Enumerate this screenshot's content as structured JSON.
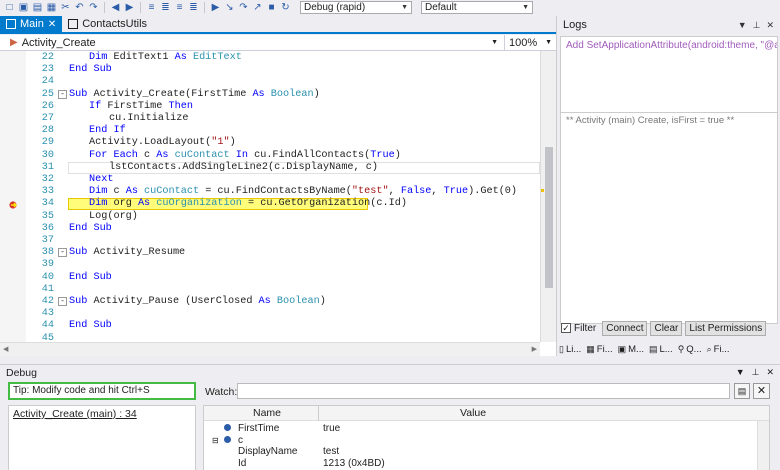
{
  "toolbar": {
    "icons": [
      "new-file-icon",
      "save-icon",
      "save-all-icon",
      "grid-icon",
      "cut-icon",
      "undo-icon",
      "redo-icon",
      "nav-back-icon",
      "nav-forward-icon",
      "indent-icon",
      "outdent-icon",
      "comment-icon",
      "uncomment-icon",
      "run-icon",
      "step-into-icon",
      "step-over-icon",
      "step-out-icon",
      "stop-icon",
      "restart-icon"
    ],
    "build_config": "Debug (rapid)",
    "device": "Default"
  },
  "editor": {
    "tabs": [
      {
        "label": "Main",
        "active": true
      },
      {
        "label": "ContactsUtils",
        "active": false
      }
    ],
    "sub_selector": "Activity_Create",
    "zoom": "100%",
    "lines": [
      {
        "n": "22",
        "indent": 1,
        "tokens": [
          [
            "kw",
            "Dim "
          ],
          [
            "",
            "EditText1 "
          ],
          [
            "kw",
            "As "
          ],
          [
            "ty",
            "EditText"
          ]
        ]
      },
      {
        "n": "23",
        "indent": 0,
        "tokens": [
          [
            "kw",
            "End Sub"
          ]
        ]
      },
      {
        "n": "24",
        "indent": 0,
        "tokens": []
      },
      {
        "n": "25",
        "indent": 0,
        "fold": "-",
        "tokens": [
          [
            "kw",
            "Sub "
          ],
          [
            "",
            "Activity_Create("
          ],
          [
            "",
            "FirstTime "
          ],
          [
            "kw",
            "As "
          ],
          [
            "ty",
            "Boolean"
          ],
          [
            "",
            ")"
          ]
        ]
      },
      {
        "n": "26",
        "indent": 1,
        "tokens": [
          [
            "kw",
            "If "
          ],
          [
            "",
            "FirstTime "
          ],
          [
            "kw",
            "Then"
          ]
        ]
      },
      {
        "n": "27",
        "indent": 2,
        "tokens": [
          [
            "",
            "cu.Initialize"
          ]
        ]
      },
      {
        "n": "28",
        "indent": 1,
        "tokens": [
          [
            "kw",
            "End If"
          ]
        ]
      },
      {
        "n": "29",
        "indent": 1,
        "tokens": [
          [
            "",
            "Activity.LoadLayout("
          ],
          [
            "st",
            "\"1\""
          ],
          [
            "",
            ")"
          ]
        ]
      },
      {
        "n": "30",
        "indent": 1,
        "tokens": [
          [
            "kw",
            "For Each "
          ],
          [
            "",
            "c "
          ],
          [
            "kw",
            "As "
          ],
          [
            "ty",
            "cuContact "
          ],
          [
            "kw",
            "In "
          ],
          [
            "",
            "cu.FindAllContacts("
          ],
          [
            "kw",
            "True"
          ],
          [
            "",
            ")"
          ]
        ]
      },
      {
        "n": "31",
        "indent": 2,
        "tokens": [
          [
            "",
            "lstContacts.AddSingleLine2(c.DisplayName, c)"
          ]
        ]
      },
      {
        "n": "32",
        "indent": 1,
        "tokens": [
          [
            "kw",
            "Next"
          ]
        ]
      },
      {
        "n": "33",
        "indent": 1,
        "tokens": [
          [
            "kw",
            "Dim "
          ],
          [
            "",
            "c "
          ],
          [
            "kw",
            "As "
          ],
          [
            "ty",
            "cuContact "
          ],
          [
            "",
            "= cu.FindContactsByName("
          ],
          [
            "st",
            "\"test\""
          ],
          [
            "",
            ", "
          ],
          [
            "kw",
            "False"
          ],
          [
            "",
            ", "
          ],
          [
            "kw",
            "True"
          ],
          [
            "",
            ").Get(0)"
          ]
        ]
      },
      {
        "n": "34",
        "indent": 1,
        "tokens": [
          [
            "kw",
            "Dim "
          ],
          [
            "",
            "org "
          ],
          [
            "kw",
            "As "
          ],
          [
            "ty",
            "cuOrganization "
          ],
          [
            "",
            "= cu.GetOrganization(c.Id)"
          ]
        ]
      },
      {
        "n": "35",
        "indent": 1,
        "tokens": [
          [
            "",
            "Log(org)"
          ]
        ]
      },
      {
        "n": "36",
        "indent": 0,
        "tokens": [
          [
            "kw",
            "End Sub"
          ]
        ]
      },
      {
        "n": "37",
        "indent": 0,
        "tokens": []
      },
      {
        "n": "38",
        "indent": 0,
        "fold": "-",
        "tokens": [
          [
            "kw",
            "Sub "
          ],
          [
            "",
            "Activity_Resume"
          ]
        ]
      },
      {
        "n": "39",
        "indent": 0,
        "tokens": []
      },
      {
        "n": "40",
        "indent": 0,
        "tokens": [
          [
            "kw",
            "End Sub"
          ]
        ]
      },
      {
        "n": "41",
        "indent": 0,
        "tokens": []
      },
      {
        "n": "42",
        "indent": 0,
        "fold": "-",
        "tokens": [
          [
            "kw",
            "Sub "
          ],
          [
            "",
            "Activity_Pause ("
          ],
          [
            "",
            "UserClosed "
          ],
          [
            "kw",
            "As "
          ],
          [
            "ty",
            "Boolean"
          ],
          [
            "",
            ")"
          ]
        ]
      },
      {
        "n": "43",
        "indent": 0,
        "tokens": []
      },
      {
        "n": "44",
        "indent": 0,
        "tokens": [
          [
            "kw",
            "End Sub"
          ]
        ]
      },
      {
        "n": "45",
        "indent": 0,
        "tokens": []
      }
    ],
    "highlighted_line": "34",
    "current_line": "31"
  },
  "logs": {
    "title": "Logs",
    "top_text": "Add SetApplicationAttribute(android:theme, \"@and",
    "log_text": "** Activity (main) Create, isFirst = true **",
    "filter_label": "Filter",
    "filter_checked": true,
    "connect_label": "Connect",
    "clear_label": "Clear",
    "list_permissions_label": "List Permissions",
    "bottom_tabs": [
      {
        "icon": "libraries-icon",
        "label": "Li..."
      },
      {
        "icon": "files-icon",
        "label": "Fi..."
      },
      {
        "icon": "modules-icon",
        "label": "M..."
      },
      {
        "icon": "logs-icon",
        "label": "L..."
      },
      {
        "icon": "quick-search-icon",
        "label": "Q..."
      },
      {
        "icon": "find-icon",
        "label": "Fi..."
      }
    ]
  },
  "debug": {
    "title": "Debug",
    "tip": "Tip: Modify code and hit Ctrl+S",
    "watch_label": "Watch:",
    "stack_frame": "Activity_Create (main) : 34",
    "columns": {
      "name": "Name",
      "value": "Value"
    },
    "variables": [
      {
        "expander": "",
        "icon": true,
        "name": "FirstTime",
        "value": "true",
        "indent": 0
      },
      {
        "expander": "⊟",
        "icon": true,
        "name": "c",
        "value": "",
        "indent": 0
      },
      {
        "expander": "",
        "icon": false,
        "name": "DisplayName",
        "value": "test",
        "indent": 1
      },
      {
        "expander": "",
        "icon": false,
        "name": "Id",
        "value": "1213 (0x4BD)",
        "indent": 1
      }
    ]
  }
}
